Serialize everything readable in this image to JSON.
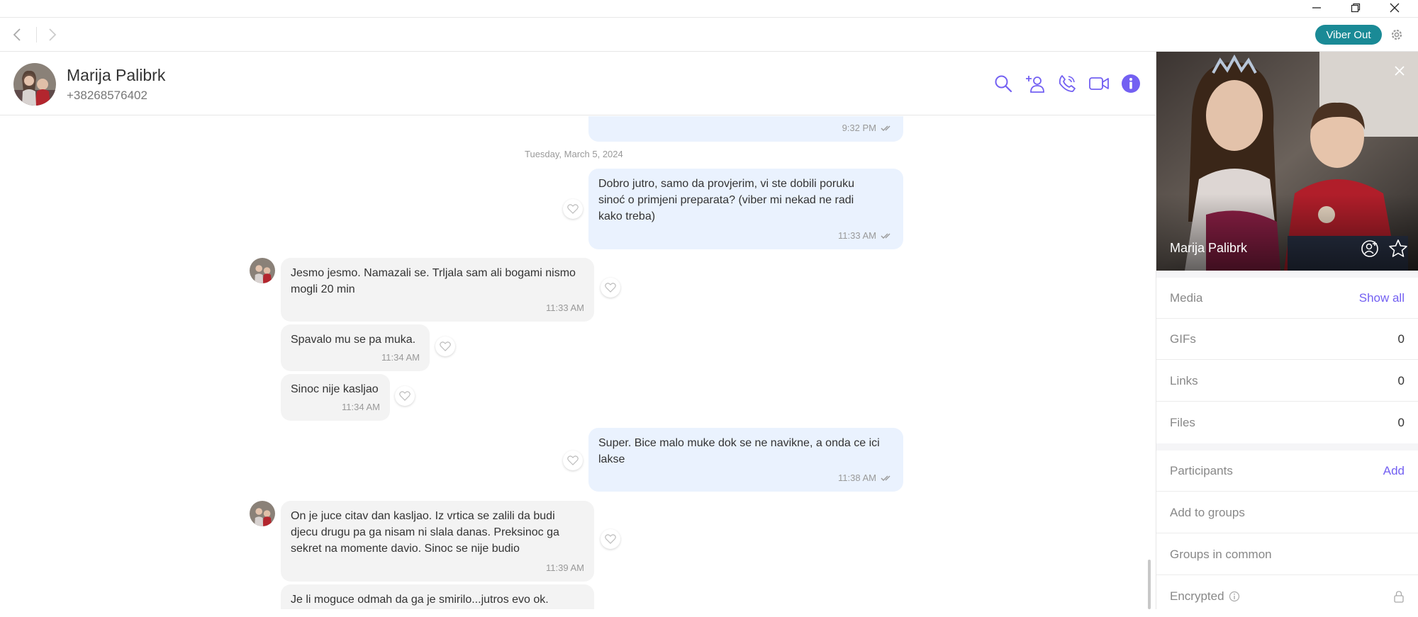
{
  "window": {
    "minimize": "minimize",
    "maximize": "restore",
    "close": "close"
  },
  "navbar": {
    "viber_out": "Viber Out"
  },
  "contact": {
    "name": "Marija Palibrk",
    "phone": "+38268576402"
  },
  "messages": {
    "prev_time": "9:32 PM",
    "date_separator": "Tuesday, March 5, 2024",
    "items": [
      {
        "dir": "out",
        "text": [
          "Dobro jutro, samo da provjerim, vi ste dobili poruku",
          "sinoć o primjeni preparata? (viber mi nekad ne radi",
          "kako treba)"
        ],
        "time": "11:33 AM"
      },
      {
        "dir": "in",
        "text": [
          "Jesmo jesmo. Namazali se. Trljala sam ali bogami nismo",
          "mogli 20 min"
        ],
        "time": "11:33 AM"
      },
      {
        "dir": "in",
        "text": [
          "Spavalo mu se pa muka."
        ],
        "time": "11:34 AM"
      },
      {
        "dir": "in",
        "text": [
          "Sinoc nije kasljao"
        ],
        "time": "11:34 AM"
      },
      {
        "dir": "out",
        "text": [
          "Super. Bice malo muke dok se ne navikne, a onda ce ici",
          "lakse"
        ],
        "time": "11:38 AM"
      },
      {
        "dir": "in",
        "text": [
          "On je juce citav dan kasljao. Iz vrtica se zalili da budi",
          "djecu drugu pa ga nisam ni slala danas. Preksinoc ga",
          "sekret na momente davio. Sinoc se nije budio"
        ],
        "time": "11:39 AM"
      },
      {
        "dir": "in",
        "text": [
          "Je li moguce odmah da ga je smirilo...jutros evo ok."
        ],
        "time": ""
      }
    ]
  },
  "panel": {
    "photo_name": "Marija Palibrk",
    "rows": [
      {
        "label": "Media",
        "action": "Show all"
      },
      {
        "label": "GIFs",
        "value": "0"
      },
      {
        "label": "Links",
        "value": "0"
      },
      {
        "label": "Files",
        "value": "0"
      },
      {
        "label": "Participants",
        "action": "Add"
      },
      {
        "label": "Add to groups"
      },
      {
        "label": "Groups in common"
      },
      {
        "label": "Encrypted"
      }
    ]
  },
  "colors": {
    "accent": "#7360f2",
    "viber_out": "#1a8a96",
    "bubble_out": "#eaf2fe",
    "bubble_in": "#f3f3f3"
  }
}
